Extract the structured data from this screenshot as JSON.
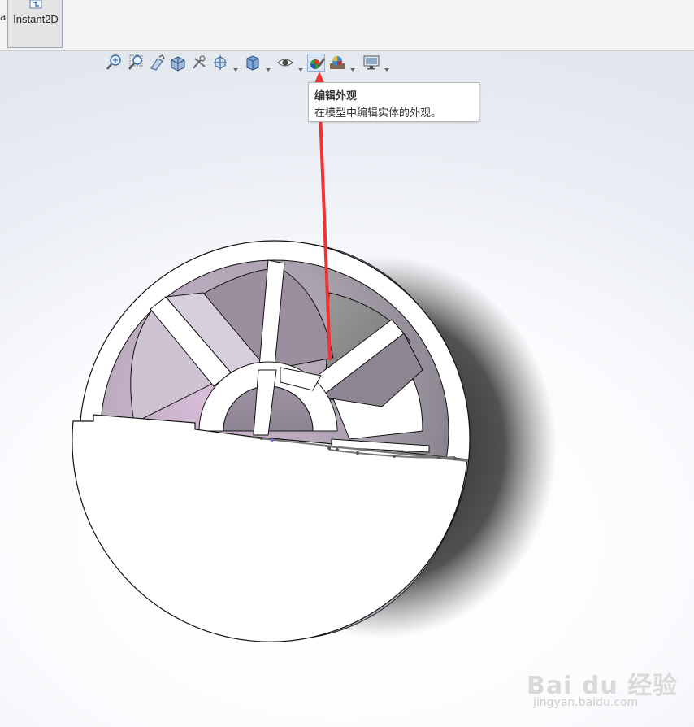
{
  "ribbon": {
    "edge_text": "а",
    "instant2d_label": "Instant2D"
  },
  "heads_up_toolbar": {
    "icons": [
      "zoom-to-fit-icon",
      "zoom-to-area-icon",
      "previous-view-icon",
      "section-view-icon",
      "dynamic-annotation-icon",
      "view-orientation-icon",
      "display-style-icon",
      "hide-show-items-icon",
      "edit-appearance-icon",
      "apply-scene-icon",
      "view-settings-icon"
    ]
  },
  "tooltip": {
    "title": "编辑外观",
    "description": "在模型中编辑实体的外观。"
  },
  "watermark": {
    "logo": "Bai du 经验",
    "url": "jingyan.baidu.com"
  },
  "colors": {
    "annotation_arrow": "#ee3333",
    "tooltip_border": "#b9b9b9",
    "viewport_bg": "#e3e7ee"
  }
}
